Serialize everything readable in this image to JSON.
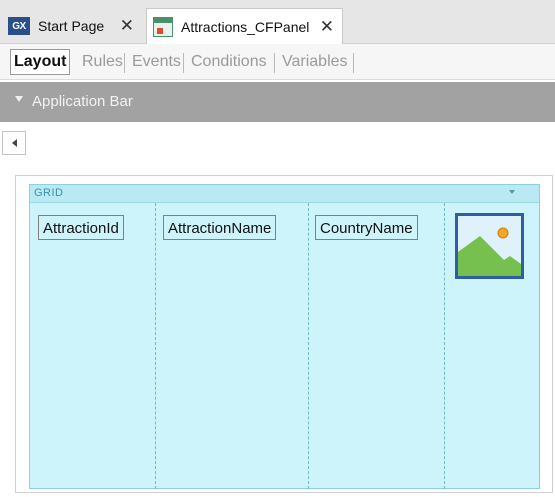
{
  "tabs": [
    {
      "label": "Start Page",
      "icon": "gx-icon"
    },
    {
      "label": "Attractions_CFPanel",
      "icon": "panel-icon"
    }
  ],
  "subtabs": [
    "Layout",
    "Rules",
    "Events",
    "Conditions",
    "Variables"
  ],
  "active_subtab": "Layout",
  "app_bar": {
    "title": "Application Bar"
  },
  "grid": {
    "label": "GRID",
    "columns": [
      "AttractionId",
      "AttractionName",
      "CountryName"
    ],
    "image_icon": "image-placeholder-icon"
  },
  "colors": {
    "grid_bg": "#cdf3fb",
    "app_bar_bg": "#a2a2a2",
    "grid_label": "#3f8fa8"
  }
}
